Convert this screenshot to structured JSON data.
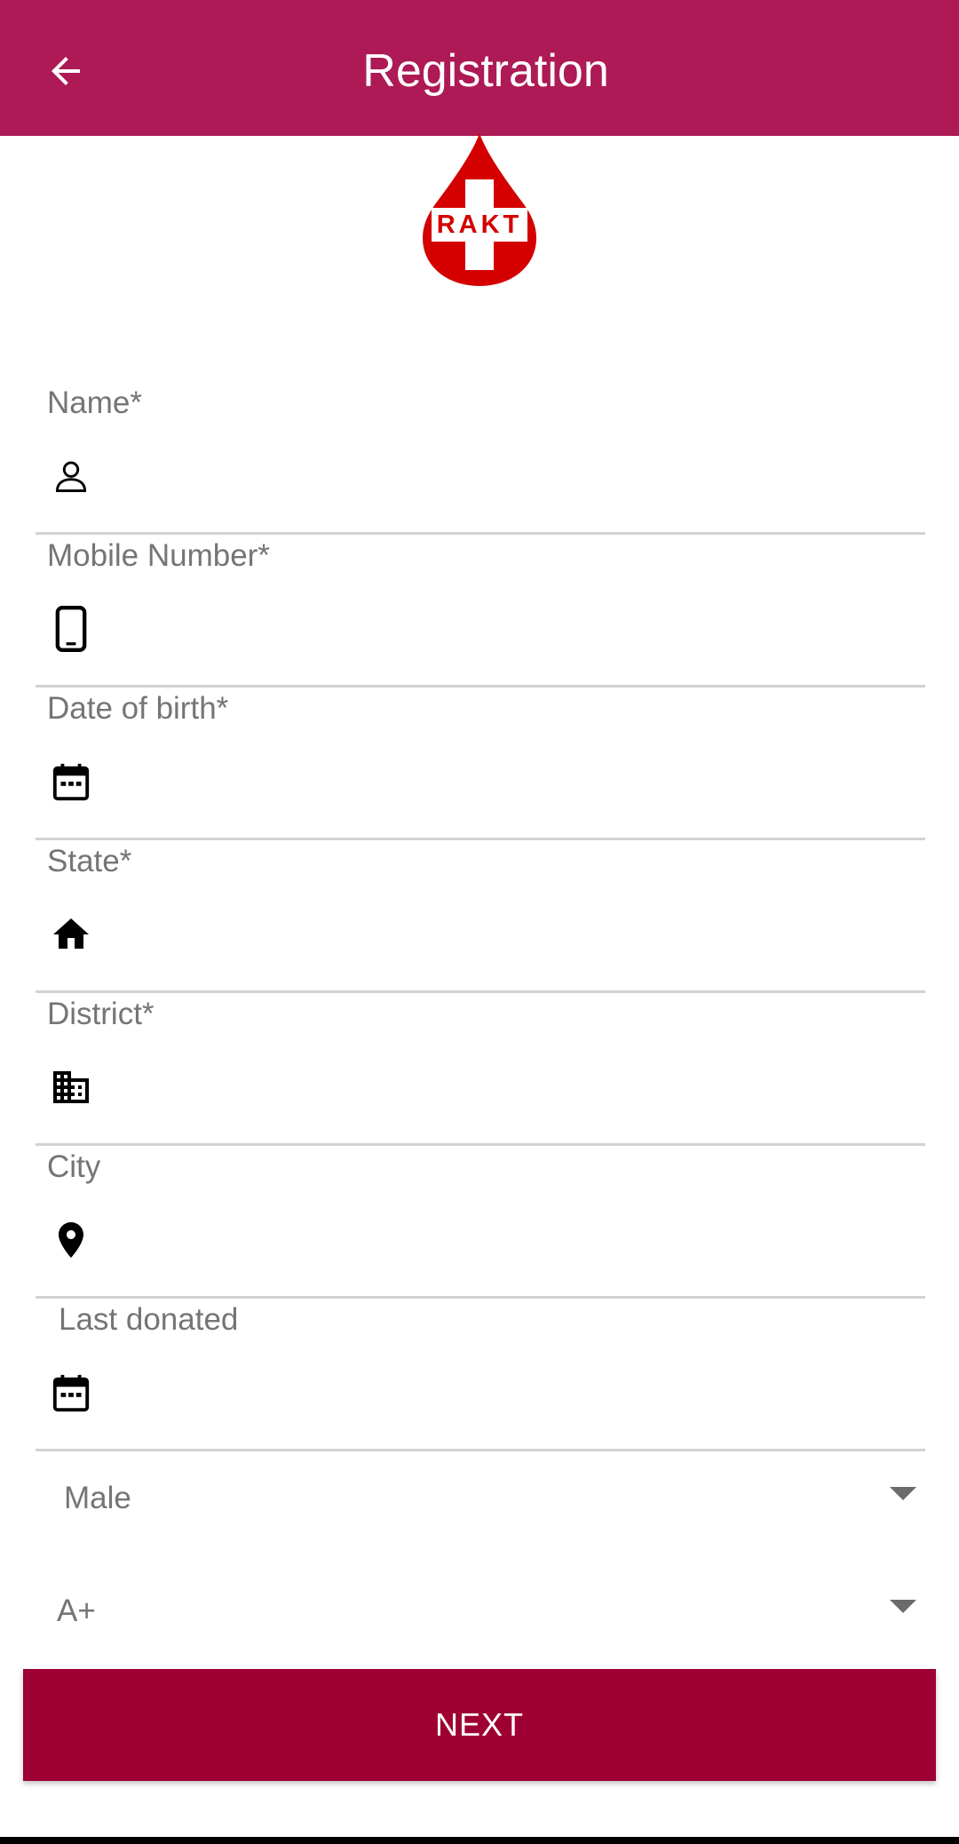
{
  "appbar": {
    "title": "Registration",
    "background": "#AD1A55",
    "back_icon": "arrow-left-icon"
  },
  "logo": {
    "text": "RAKT",
    "color": "#D40000"
  },
  "fields": [
    {
      "label": "Name*",
      "icon": "person-icon",
      "value": ""
    },
    {
      "label": "Mobile Number*",
      "icon": "phone-icon",
      "value": ""
    },
    {
      "label": "Date of birth*",
      "icon": "calendar-icon",
      "value": ""
    },
    {
      "label": "State*",
      "icon": "home-icon",
      "value": ""
    },
    {
      "label": "District*",
      "icon": "building-icon",
      "value": ""
    },
    {
      "label": "City",
      "icon": "location-pin-icon",
      "value": ""
    },
    {
      "label": "Last donated",
      "icon": "calendar-icon",
      "value": ""
    }
  ],
  "gender_select": {
    "value": "Male"
  },
  "blood_group_select": {
    "value": "A+"
  },
  "next_button": {
    "label": "NEXT",
    "color": "#9E0033"
  }
}
